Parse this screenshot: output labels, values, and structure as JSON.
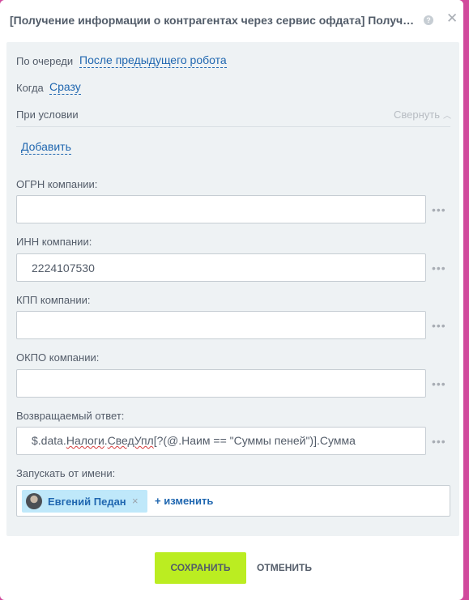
{
  "dialog": {
    "title": "[Получение информации о контрагентах через сервис офдата] Получен...",
    "help_icon": "?",
    "close_icon": "✕"
  },
  "settings": {
    "queue_label": "По очереди",
    "queue_value": "После предыдущего робота",
    "when_label": "Когда",
    "when_value": "Сразу",
    "condition_label": "При условии",
    "collapse_label": "Свернуть",
    "add_label": "Добавить"
  },
  "fields": {
    "ogrn": {
      "label": "ОГРН компании:",
      "value": ""
    },
    "inn": {
      "label": "ИНН компании:",
      "value": "2224107530"
    },
    "kpp": {
      "label": "КПП компании:",
      "value": ""
    },
    "okpo": {
      "label": "ОКПО компании:",
      "value": ""
    },
    "response": {
      "label": "Возвращаемый ответ:",
      "parts": [
        "$.data.",
        "Налоги",
        ".",
        "СведУпл",
        "[?(@.Наим == \"Суммы пеней\")].Сумма"
      ]
    }
  },
  "run_as": {
    "label": "Запускать от имени:",
    "user_name": "Евгений Педан",
    "remove_icon": "×",
    "change_label": "+ изменить"
  },
  "more_icon": "•••",
  "footer": {
    "save_label": "СОХРАНИТЬ",
    "cancel_label": "ОТМЕНИТЬ"
  },
  "colors": {
    "accent": "#2067b0",
    "save_button": "#bbed21",
    "panel_bg": "#eef2f4",
    "chip_bg": "#bfe8fa"
  }
}
